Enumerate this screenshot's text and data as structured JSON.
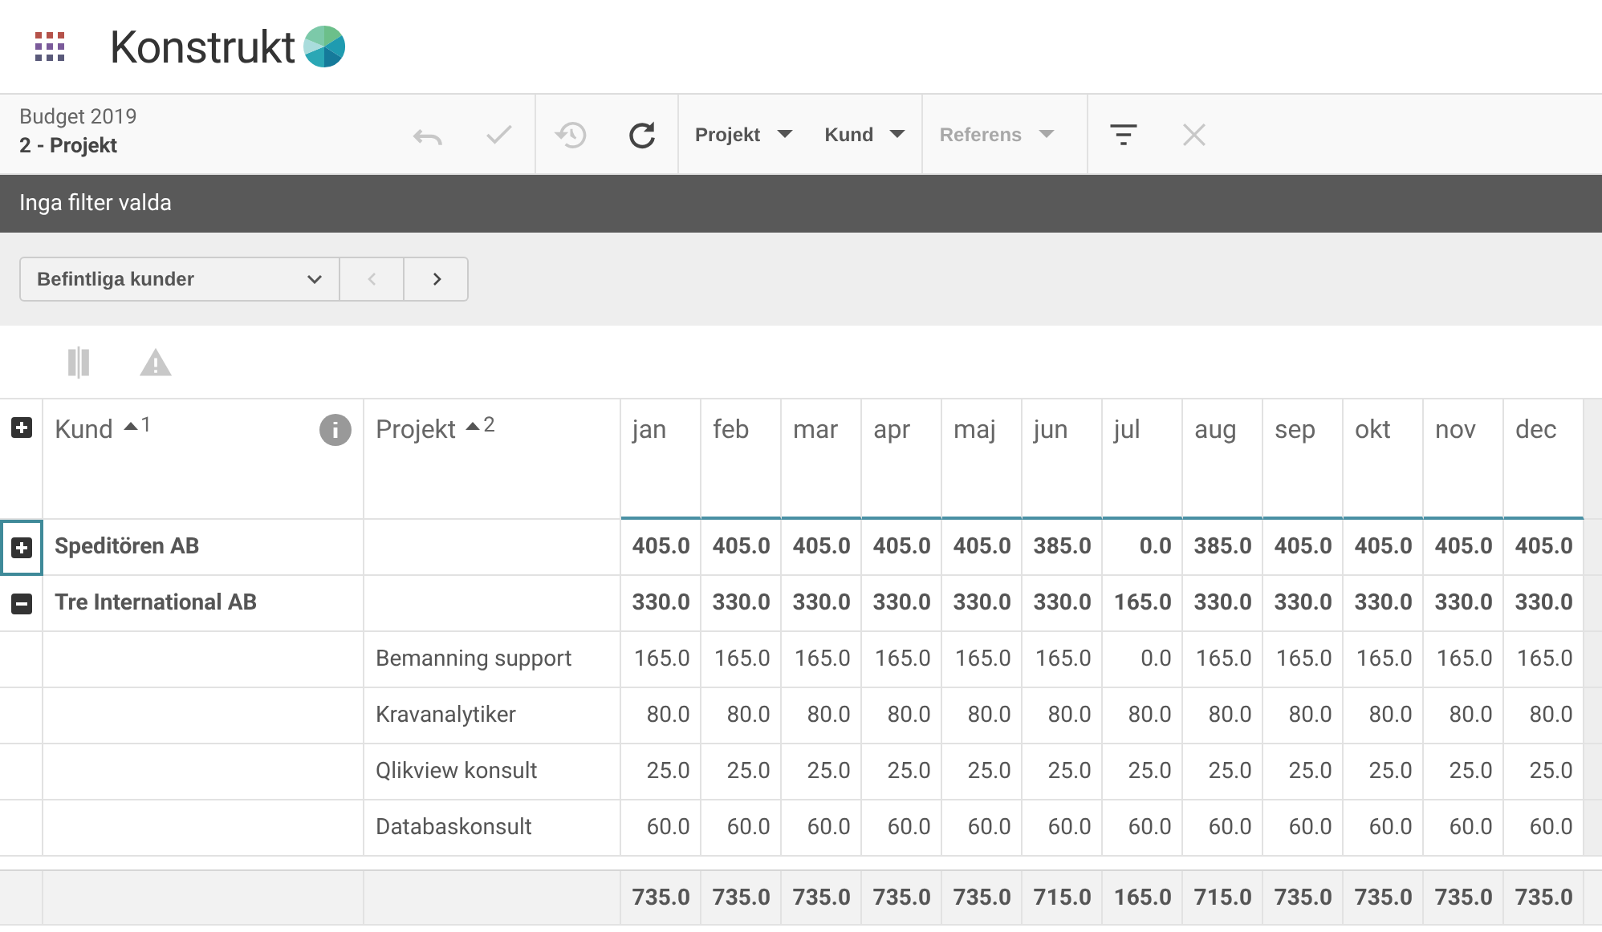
{
  "header": {
    "logo": "Konstrukt"
  },
  "toolbar": {
    "title": "Budget 2019",
    "subtitle": "2 - Projekt",
    "actions": [
      {
        "kind": "undo",
        "disabled": true
      },
      {
        "kind": "check",
        "disabled": true
      },
      {
        "kind": "divider"
      },
      {
        "kind": "history",
        "disabled": true
      },
      {
        "kind": "refresh",
        "disabled": false
      },
      {
        "kind": "divider"
      }
    ],
    "dropdowns": [
      {
        "label": "Projekt",
        "disabled": false
      },
      {
        "label": "Kund",
        "disabled": false
      },
      {
        "label": "Referens",
        "disabled": true
      }
    ],
    "tools": [
      {
        "kind": "filter",
        "disabled": false
      },
      {
        "kind": "clear",
        "disabled": true
      }
    ]
  },
  "filter_bar": {
    "text": "Inga filter valda"
  },
  "selector": {
    "value": "Befintliga kunder",
    "prev_disabled": true,
    "next_disabled": false
  },
  "view_icons": [
    {
      "kind": "compare",
      "disabled": true
    },
    {
      "kind": "warning",
      "disabled": true
    }
  ],
  "table": {
    "columns": [
      {
        "label": "Kund",
        "sort": "1",
        "info": true
      },
      {
        "label": "Projekt",
        "sort": "2",
        "info": false
      }
    ],
    "months": [
      "jan",
      "feb",
      "mar",
      "apr",
      "maj",
      "jun",
      "jul",
      "aug",
      "sep",
      "okt",
      "nov",
      "dec"
    ],
    "rows": [
      {
        "kind": "group",
        "name": "Speditören AB",
        "expanded": false,
        "selected": true,
        "values": [
          "405.0",
          "405.0",
          "405.0",
          "405.0",
          "405.0",
          "385.0",
          "0.0",
          "385.0",
          "405.0",
          "405.0",
          "405.0",
          "405.0"
        ]
      },
      {
        "kind": "group",
        "name": "Tre International AB",
        "expanded": true,
        "selected": false,
        "values": [
          "330.0",
          "330.0",
          "330.0",
          "330.0",
          "330.0",
          "330.0",
          "165.0",
          "330.0",
          "330.0",
          "330.0",
          "330.0",
          "330.0"
        ]
      },
      {
        "kind": "project",
        "name": "Bemanning support",
        "values": [
          "165.0",
          "165.0",
          "165.0",
          "165.0",
          "165.0",
          "165.0",
          "0.0",
          "165.0",
          "165.0",
          "165.0",
          "165.0",
          "165.0"
        ]
      },
      {
        "kind": "project",
        "name": "Kravanalytiker",
        "values": [
          "80.0",
          "80.0",
          "80.0",
          "80.0",
          "80.0",
          "80.0",
          "80.0",
          "80.0",
          "80.0",
          "80.0",
          "80.0",
          "80.0"
        ]
      },
      {
        "kind": "project",
        "name": "Qlikview konsult",
        "values": [
          "25.0",
          "25.0",
          "25.0",
          "25.0",
          "25.0",
          "25.0",
          "25.0",
          "25.0",
          "25.0",
          "25.0",
          "25.0",
          "25.0"
        ]
      },
      {
        "kind": "project",
        "name": "Databaskonsult",
        "values": [
          "60.0",
          "60.0",
          "60.0",
          "60.0",
          "60.0",
          "60.0",
          "60.0",
          "60.0",
          "60.0",
          "60.0",
          "60.0",
          "60.0"
        ]
      }
    ],
    "totals": [
      "735.0",
      "735.0",
      "735.0",
      "735.0",
      "735.0",
      "715.0",
      "165.0",
      "715.0",
      "735.0",
      "735.0",
      "735.0",
      "735.0"
    ]
  }
}
